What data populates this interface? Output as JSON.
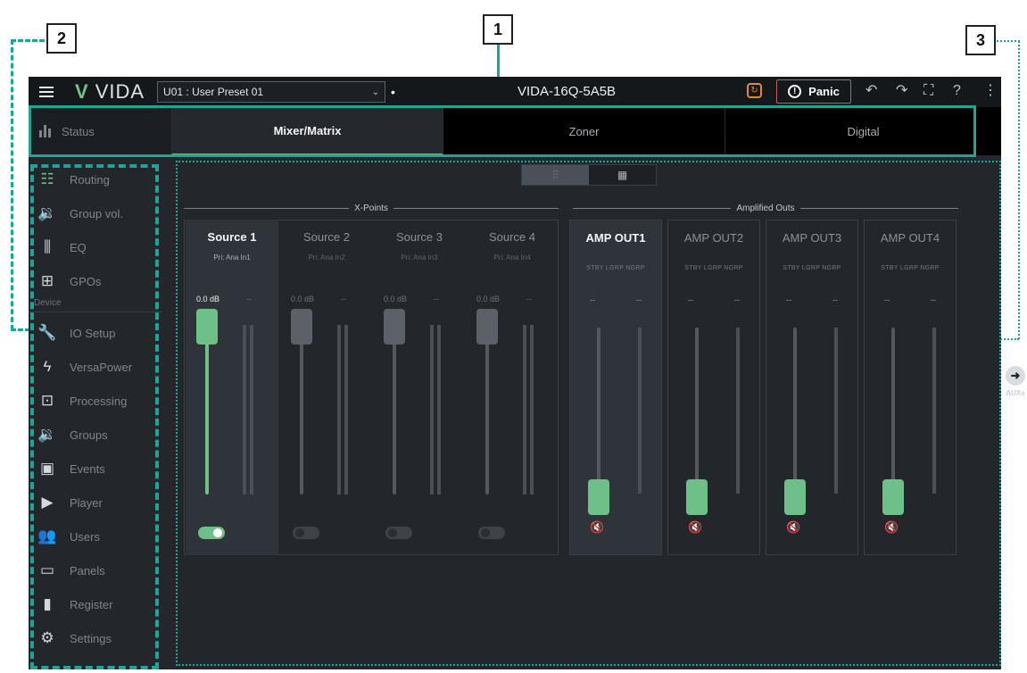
{
  "callouts": {
    "one": "1",
    "two": "2",
    "three": "3"
  },
  "topbar": {
    "logo_mark": "V",
    "logo_text": "VIDA",
    "preset_value": "U01 : User Preset 01",
    "preset_dirty": "•",
    "device_name": "VIDA-16Q-5A5B",
    "panic_label": "Panic"
  },
  "tabs": {
    "status_label": "Status",
    "items": [
      {
        "label": "Mixer/Matrix",
        "active": true
      },
      {
        "label": "Zoner",
        "active": false
      },
      {
        "label": "Digital",
        "active": false
      }
    ]
  },
  "sidebar": {
    "device_label": "Device",
    "items": [
      {
        "label": "Routing",
        "icon": "routing-icon"
      },
      {
        "label": "Group vol.",
        "icon": "speaker-icon"
      },
      {
        "label": "EQ",
        "icon": "eq-icon"
      },
      {
        "label": "GPOs",
        "icon": "gpo-icon"
      },
      {
        "label": "IO Setup",
        "icon": "wrench-icon"
      },
      {
        "label": "VersaPower",
        "icon": "bolt-icon"
      },
      {
        "label": "Processing",
        "icon": "chip-icon"
      },
      {
        "label": "Groups",
        "icon": "speaker-icon"
      },
      {
        "label": "Events",
        "icon": "calendar-icon"
      },
      {
        "label": "Player",
        "icon": "play-icon"
      },
      {
        "label": "Users",
        "icon": "users-icon"
      },
      {
        "label": "Panels",
        "icon": "panels-icon"
      },
      {
        "label": "Register",
        "icon": "document-icon"
      },
      {
        "label": "Settings",
        "icon": "gear-icon"
      }
    ]
  },
  "mixer": {
    "xpoints_title": "X-Points",
    "amp_title": "Amplified Outs",
    "sources": [
      {
        "name": "Source 1",
        "sub": "Pri: Ana In1",
        "gain": "0.0 dB",
        "dash": "--",
        "enabled": true,
        "level": 1.0
      },
      {
        "name": "Source 2",
        "sub": "Pri: Ana In2",
        "gain": "0.0 dB",
        "dash": "--",
        "enabled": false,
        "level": 1.0
      },
      {
        "name": "Source 3",
        "sub": "Pri: Ana In3",
        "gain": "0.0 dB",
        "dash": "--",
        "enabled": false,
        "level": 1.0
      },
      {
        "name": "Source 4",
        "sub": "Pri: Ana In4",
        "gain": "0.0 dB",
        "dash": "--",
        "enabled": false,
        "level": 1.0
      }
    ],
    "outputs": [
      {
        "name": "AMP OUT1",
        "flags": "STBY LGRP NGRP",
        "dash": "--",
        "dash2": "--",
        "level": 0.05
      },
      {
        "name": "AMP OUT2",
        "flags": "STBY LGRP NGRP",
        "dash": "--",
        "dash2": "--",
        "level": 0.05
      },
      {
        "name": "AMP OUT3",
        "flags": "STBY LGRP NGRP",
        "dash": "--",
        "dash2": "--",
        "level": 0.05
      },
      {
        "name": "AMP OUT4",
        "flags": "STBY LGRP NGRP",
        "dash": "--",
        "dash2": "--",
        "level": 0.05
      }
    ],
    "aux_label": "AUXs"
  },
  "colors": {
    "accent": "#6fbf88",
    "callout": "#1ea596",
    "panic": "#c85a5a",
    "sync": "#e08b2d"
  }
}
